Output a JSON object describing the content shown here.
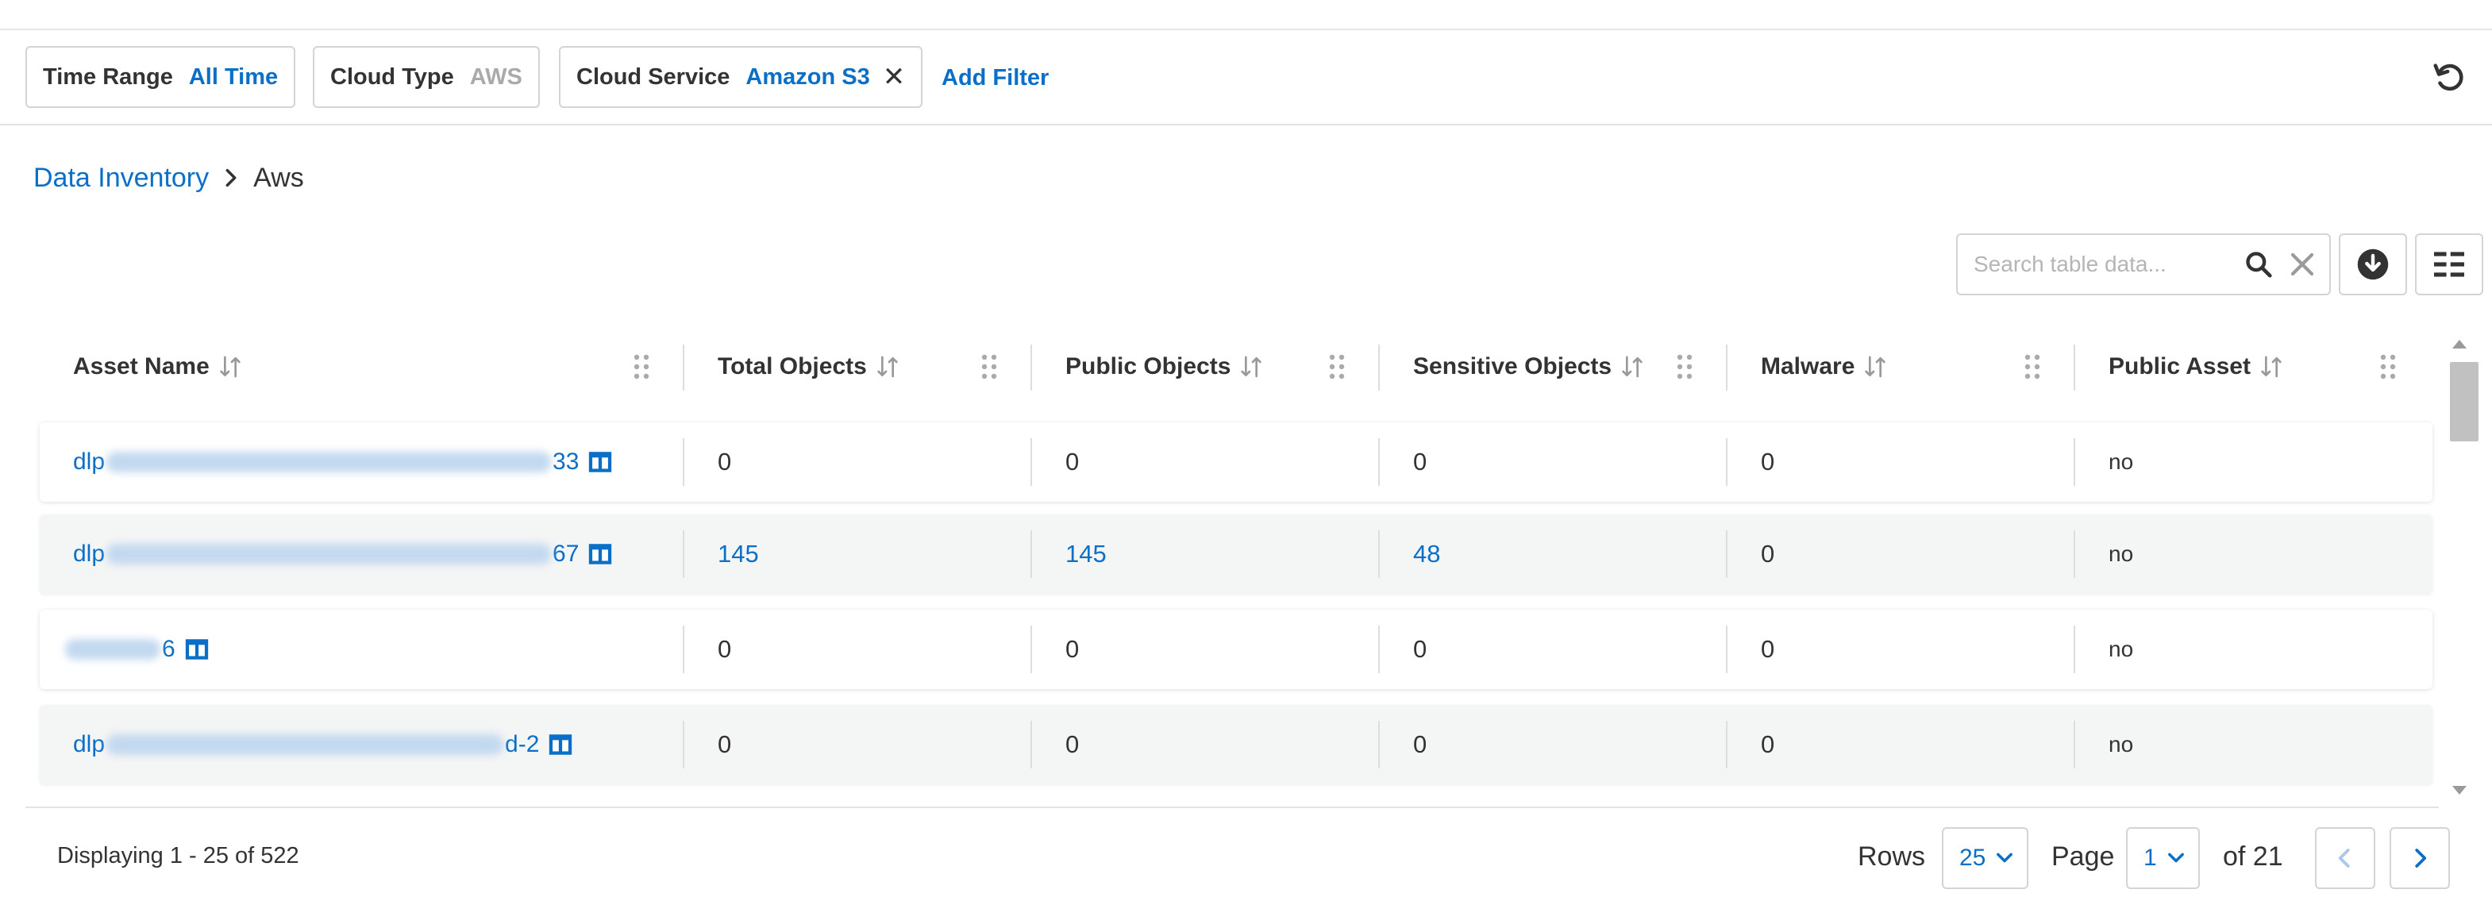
{
  "filters": [
    {
      "key": "Time Range",
      "value": "All Time",
      "muted": false,
      "removable": false
    },
    {
      "key": "Cloud Type",
      "value": "AWS",
      "muted": true,
      "removable": false
    },
    {
      "key": "Cloud Service",
      "value": "Amazon S3",
      "muted": false,
      "removable": true
    }
  ],
  "add_filter_label": "Add Filter",
  "breadcrumb": {
    "parent": "Data Inventory",
    "current": "Aws"
  },
  "search": {
    "placeholder": "Search table data..."
  },
  "columns": [
    "Asset Name",
    "Total Objects",
    "Public Objects",
    "Sensitive Objects",
    "Malware",
    "Public Asset"
  ],
  "rows": [
    {
      "asset_prefix": "dlp",
      "asset_suffix": "33",
      "total": "0",
      "public": "0",
      "sensitive": "0",
      "malware": "0",
      "public_asset": "no"
    },
    {
      "asset_prefix": "dlp",
      "asset_suffix": "67",
      "total": "145",
      "public": "145",
      "sensitive": "48",
      "malware": "0",
      "public_asset": "no"
    },
    {
      "asset_prefix": "",
      "asset_suffix": "6",
      "total": "0",
      "public": "0",
      "sensitive": "0",
      "malware": "0",
      "public_asset": "no"
    },
    {
      "asset_prefix": "dlp",
      "asset_suffix": "d-2",
      "total": "0",
      "public": "0",
      "sensitive": "0",
      "malware": "0",
      "public_asset": "no"
    }
  ],
  "footer": {
    "displaying": "Displaying 1 - 25 of 522",
    "rows_label": "Rows",
    "rows_value": "25",
    "page_label": "Page",
    "page_value": "1",
    "of_pages": "of 21"
  },
  "colors": {
    "accent": "#0b6fc7",
    "muted": "#aaaaaa",
    "row_alt": "#f4f5f5"
  }
}
